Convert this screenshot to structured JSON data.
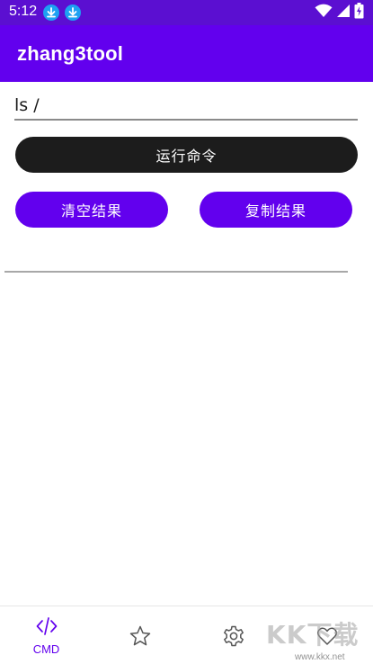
{
  "status_bar": {
    "time": "5:12",
    "notification_icons": [
      "download-icon",
      "download-icon"
    ],
    "system_icons": [
      "wifi-icon",
      "cellular-signal-icon",
      "battery-charging-icon"
    ],
    "background_color": "#5b0fd1"
  },
  "app_bar": {
    "title": "zhang3tool",
    "background_color": "#6200ee"
  },
  "command_input": {
    "value": "ls /"
  },
  "buttons": {
    "run_label": "运行命令",
    "clear_label": "清空结果",
    "copy_label": "复制结果"
  },
  "bottom_nav": {
    "items": [
      {
        "icon": "code-icon",
        "label": "CMD",
        "selected": true
      },
      {
        "icon": "star-icon",
        "label": "",
        "selected": false
      },
      {
        "icon": "gear-icon",
        "label": "",
        "selected": false
      },
      {
        "icon": "heart-icon",
        "label": "",
        "selected": false
      }
    ],
    "accent_color": "#6200ee"
  },
  "watermark": {
    "text": "KK下载",
    "url": "www.kkx.net"
  }
}
